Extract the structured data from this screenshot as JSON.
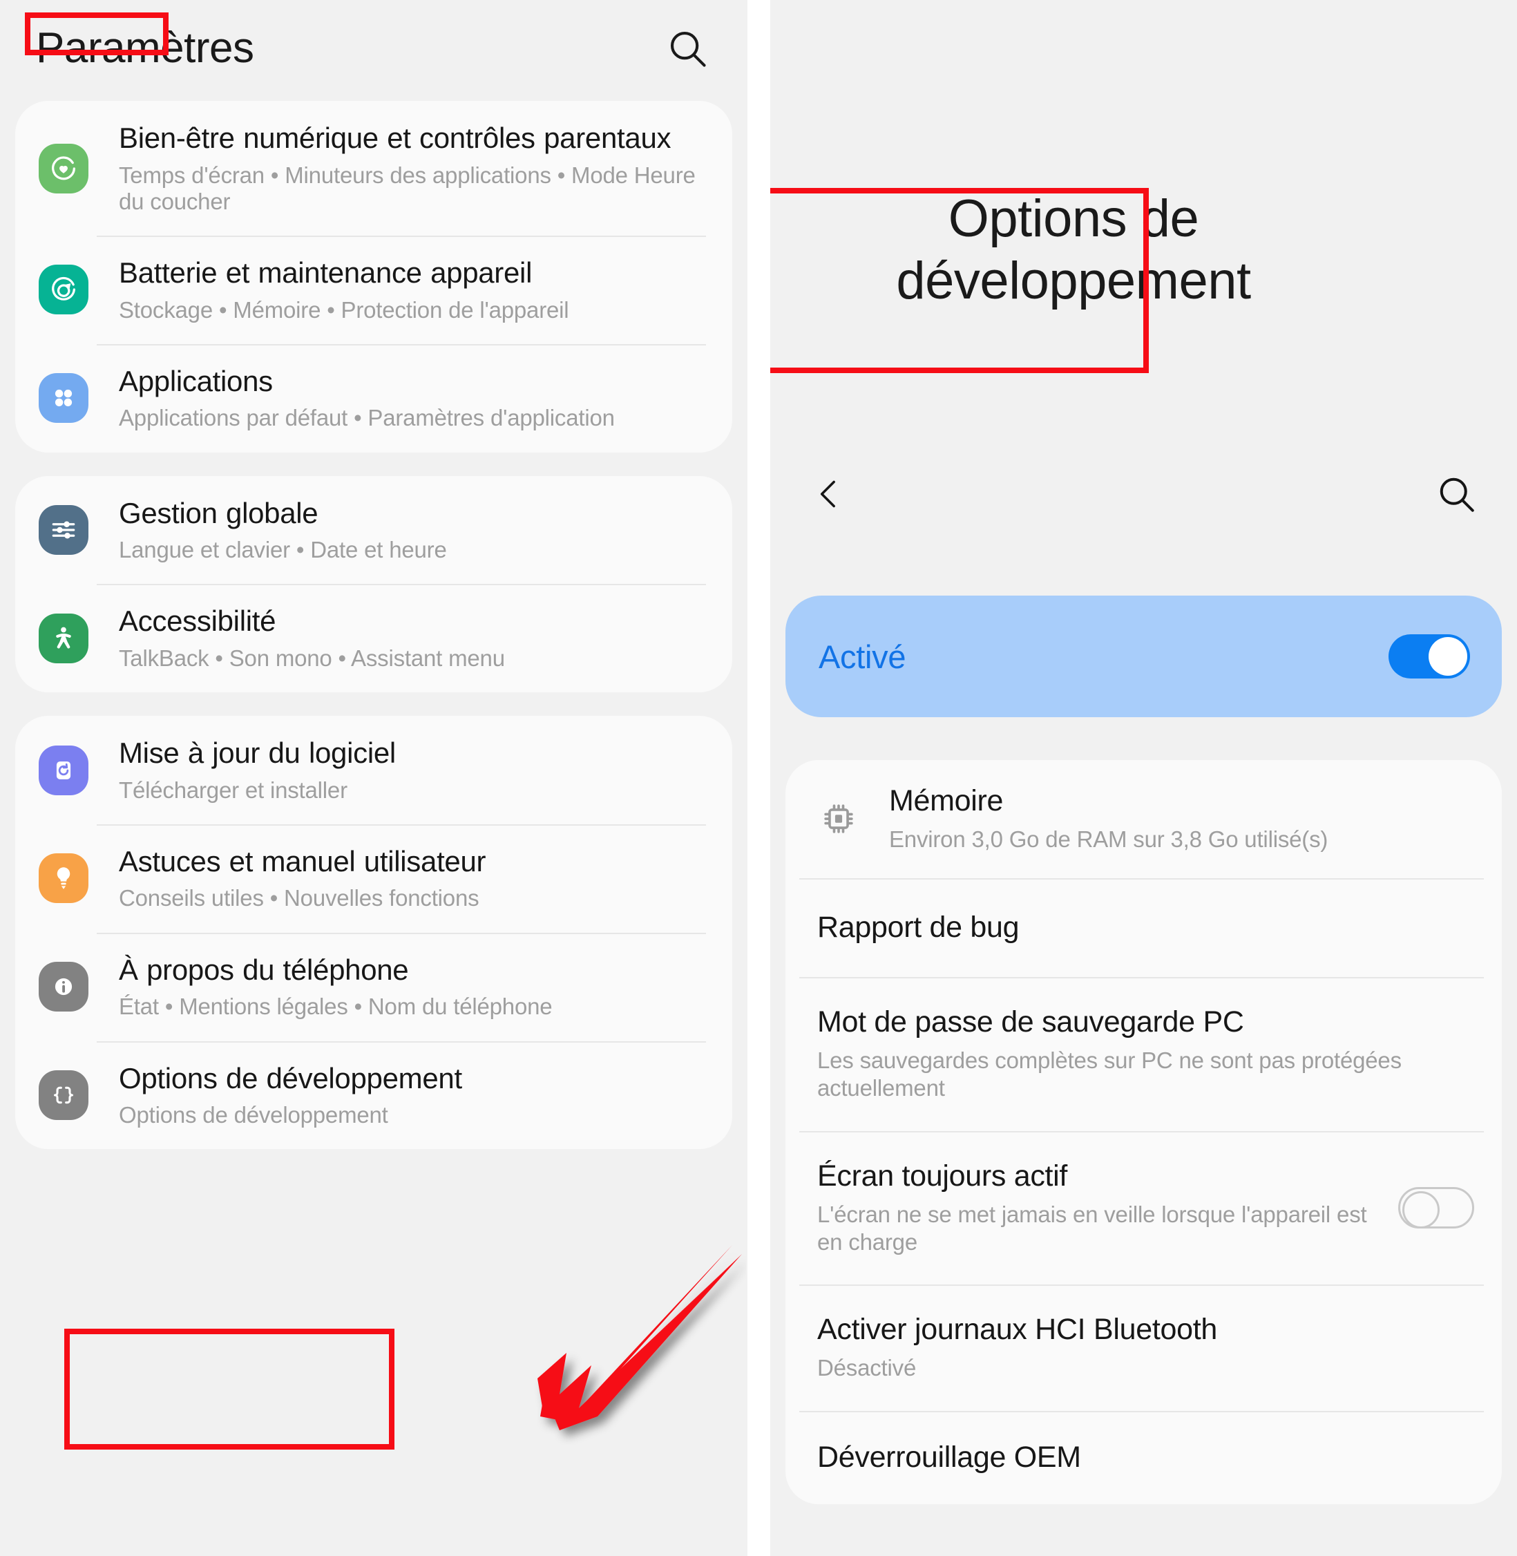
{
  "left": {
    "title": "Paramètres",
    "search_icon": "search-icon",
    "groups": [
      {
        "items": [
          {
            "icon": "digital-wellbeing-icon",
            "icon_color": "#6cbf6a",
            "title": "Bien-être numérique et contrôles parentaux",
            "subtitle": "Temps d'écran • Minuteurs des applications • Mode Heure du coucher"
          },
          {
            "icon": "battery-care-icon",
            "icon_color": "#06b394",
            "title": "Batterie et maintenance appareil",
            "subtitle": "Stockage • Mémoire • Protection de l'appareil"
          },
          {
            "icon": "apps-grid-icon",
            "icon_color": "#74aaf0",
            "title": "Applications",
            "subtitle": "Applications par défaut • Paramètres d'application"
          }
        ]
      },
      {
        "items": [
          {
            "icon": "sliders-icon",
            "icon_color": "#527089",
            "title": "Gestion globale",
            "subtitle": "Langue et clavier • Date et heure"
          },
          {
            "icon": "accessibility-person-icon",
            "icon_color": "#2fa05c",
            "title": "Accessibilité",
            "subtitle": "TalkBack • Son mono • Assistant menu"
          }
        ]
      },
      {
        "items": [
          {
            "icon": "software-update-icon",
            "icon_color": "#7b7ff0",
            "title": "Mise à jour du logiciel",
            "subtitle": "Télécharger et installer"
          },
          {
            "icon": "lightbulb-tips-icon",
            "icon_color": "#f8a247",
            "title": "Astuces et manuel utilisateur",
            "subtitle": "Conseils utiles • Nouvelles fonctions"
          },
          {
            "icon": "info-circle-icon",
            "icon_color": "#828282",
            "title": "À propos du téléphone",
            "subtitle": "État • Mentions légales • Nom du téléphone"
          },
          {
            "icon": "curly-braces-icon",
            "icon_color": "#828282",
            "title": "Options de développement",
            "subtitle": "Options de développement"
          }
        ]
      }
    ]
  },
  "right": {
    "hero_title": "Options de développement",
    "back_icon": "chevron-left-icon",
    "search_icon": "search-icon",
    "enable": {
      "label": "Activé",
      "state": "on"
    },
    "items": [
      {
        "icon": "memory-chip-icon",
        "title": "Mémoire",
        "subtitle": "Environ 3,0 Go de RAM sur 3,8 Go utilisé(s)",
        "toggle": null
      },
      {
        "icon": null,
        "title": "Rapport de bug",
        "subtitle": null,
        "toggle": null
      },
      {
        "icon": null,
        "title": "Mot de passe de sauvegarde PC",
        "subtitle": "Les sauvegardes complètes sur PC ne sont pas protégées actuellement",
        "toggle": null
      },
      {
        "icon": null,
        "title": "Écran toujours actif",
        "subtitle": "L'écran ne se met jamais en veille lorsque l'appareil est en charge",
        "toggle": "off"
      },
      {
        "icon": null,
        "title": "Activer journaux HCI Bluetooth",
        "subtitle": "Désactivé",
        "toggle": null
      },
      {
        "icon": null,
        "title": "Déverrouillage OEM",
        "subtitle": null,
        "toggle": null
      }
    ]
  },
  "annotations": {
    "highlight_color": "#f60d16",
    "arrow_color": "#f60d16",
    "boxes": [
      "paramètres-title",
      "options-de-développement-row",
      "options-de-développement-hero"
    ]
  }
}
